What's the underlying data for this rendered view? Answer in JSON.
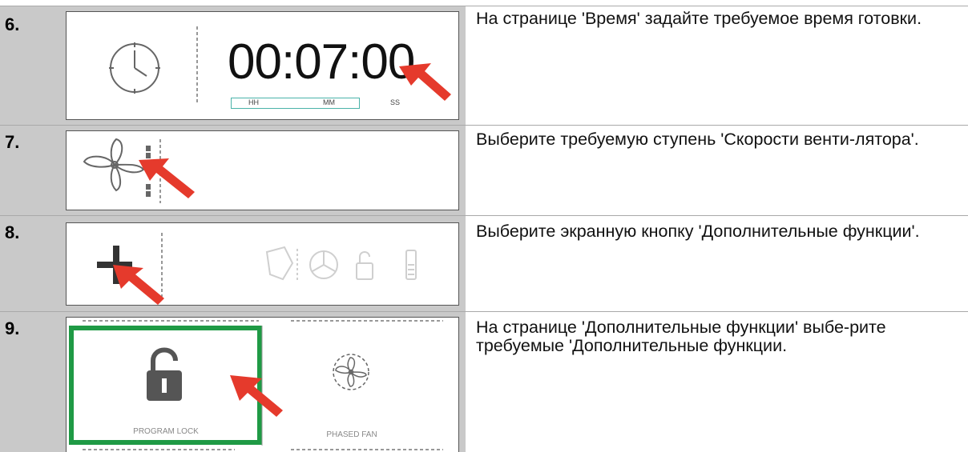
{
  "steps": [
    {
      "number": "6.",
      "text": "На странице 'Время' задайте требуемое время готовки."
    },
    {
      "number": "7.",
      "text": "Выберите требуемую ступень 'Скорости венти-лятора'."
    },
    {
      "number": "8.",
      "text": "Выберите экранную кнопку 'Дополнительные функции'."
    },
    {
      "number": "9.",
      "text": "На странице 'Дополнительные функции' выбе-рите требуемые 'Дополнительные функции."
    }
  ],
  "timer": {
    "time": "00:07:00",
    "hh": "HH",
    "mm": "MM",
    "ss": "SS"
  },
  "extra_functions": {
    "lock_label": "PROGRAM LOCK",
    "fan_label": "PHASED FAN"
  },
  "colors": {
    "band": "#c9c9c9",
    "arrow": "#e53a2c",
    "highlight": "#1f9a45",
    "teal": "#4ab3a9"
  }
}
